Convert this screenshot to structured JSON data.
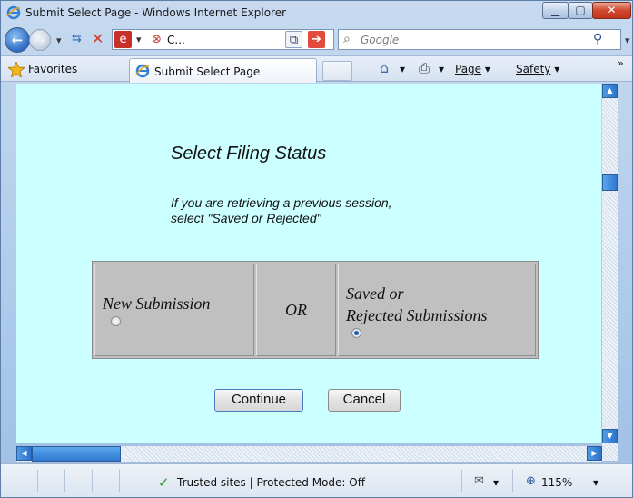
{
  "window": {
    "title": "Submit Select Page - Windows Internet Explorer",
    "minimize_icon": "minimize-icon",
    "maximize_icon": "maximize-icon",
    "close_icon": "close-icon"
  },
  "navbar": {
    "address_text": "C...",
    "search_placeholder": "Google",
    "back_icon": "back-arrow-icon",
    "forward_icon": "forward-arrow-icon"
  },
  "favorites_bar": {
    "favorites_label": "Favorites",
    "tab_label": "Submit Select Page",
    "page_menu": "Page",
    "safety_menu": "Safety",
    "chevron": "»"
  },
  "page": {
    "heading": "Select Filing Status",
    "instruction_line1": "If you are retrieving a previous session,",
    "instruction_line2": "select \"Saved or Rejected\"",
    "options": {
      "new_submission_label": "New Submission",
      "or_label": "OR",
      "saved_line1": "Saved or",
      "saved_line2": "Rejected Submissions",
      "selected": "saved_or_rejected"
    },
    "continue_button": "Continue",
    "cancel_button": "Cancel"
  },
  "statusbar": {
    "zone_text": "Trusted sites | Protected Mode: Off",
    "zoom": "115%"
  }
}
